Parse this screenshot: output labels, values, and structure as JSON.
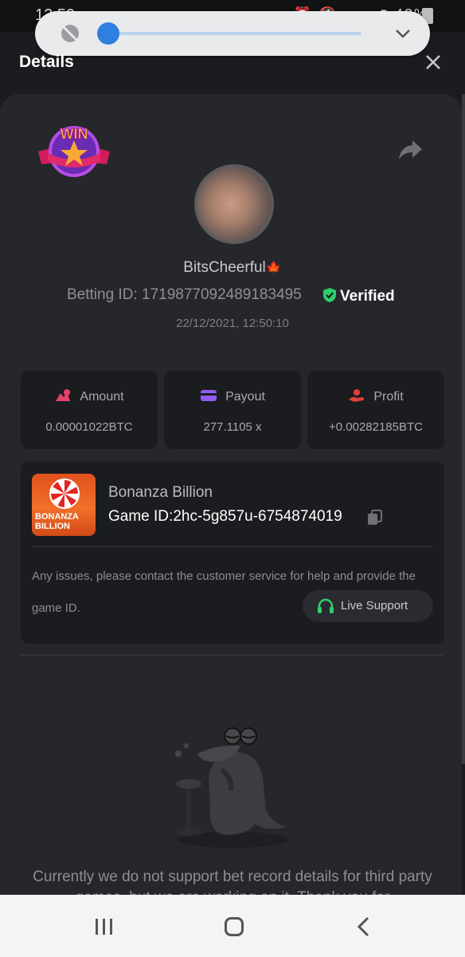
{
  "status_bar": {
    "time": "12:50",
    "battery": "43%"
  },
  "header": {
    "title": "Details"
  },
  "user": {
    "name": "BitsCheerful",
    "name_suffix": "🍁",
    "betting_id_label": "Betting ID:",
    "betting_id": "1719877092489183495",
    "verified": "Verified",
    "timestamp": "22/12/2021, 12:50:10"
  },
  "stats": [
    {
      "label": "Amount",
      "value": "0.00001022BTC",
      "icon": "coins-icon",
      "color": "#e8436b"
    },
    {
      "label": "Payout",
      "value": "277.1105 x",
      "icon": "wallet-icon",
      "color": "#8e5cf0"
    },
    {
      "label": "Profit",
      "value": "+0.00282185BTC",
      "icon": "hand-coin-icon",
      "color": "#e0403a"
    }
  ],
  "game": {
    "thumb_text": "BONANZA BILLION",
    "name": "Bonanza Billion",
    "id_label": "Game ID:",
    "id": "2hc-5g857u-6754874019",
    "issue_text": "Any issues, please contact the customer service for help and provide the game ID.",
    "support_label": "Live Support",
    "support_color": "#2fcf6b"
  },
  "notice": "Currently we do not support bet record details for third party games, but we are working on it. Thank you for",
  "badge_text": "WIN",
  "volume": {
    "level": 0.0
  }
}
